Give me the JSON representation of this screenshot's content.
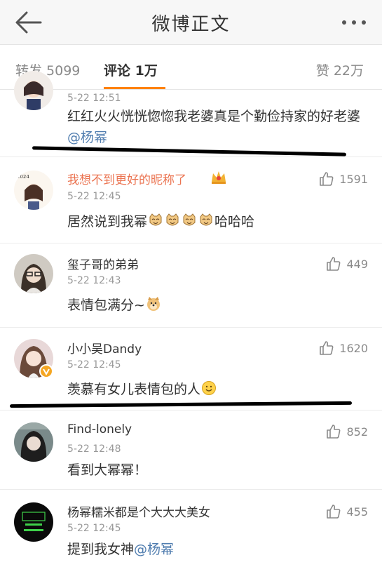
{
  "header": {
    "title": "微博正文"
  },
  "tabs": {
    "repost": "转发 5099",
    "comment": "评论 1万",
    "like": "赞 22万"
  },
  "comments": [
    {
      "time": "5-22 12:51",
      "text": "红红火火恍恍惚惚我老婆真是个勤俭持家的好老婆",
      "mention": "@杨幂"
    },
    {
      "name": "我想不到更好的昵称了",
      "time": "5-22 12:45",
      "text": "居然说到我幂",
      "text_suffix": "哈哈哈",
      "likes": "1591"
    },
    {
      "name": "玺子哥的弟弟",
      "time": "5-22 12:43",
      "text": "表情包满分~",
      "likes": "449"
    },
    {
      "name": "小小吴Dandy",
      "time": "5-22 12:45",
      "text": "羡慕有女儿表情包的人",
      "likes": "1620"
    },
    {
      "name": "Find-lonely",
      "time": "5-22 12:48",
      "text": "看到大幂幂！",
      "likes": "852"
    },
    {
      "name": "杨幂糯米都是个大大大美女",
      "time": "5-22 12:45",
      "text": "提到我女神",
      "mention": "@杨幂",
      "likes": "455"
    }
  ],
  "colors": {
    "accent": "#ff8200",
    "vip_name": "#eb7350",
    "mention": "#507daf"
  }
}
